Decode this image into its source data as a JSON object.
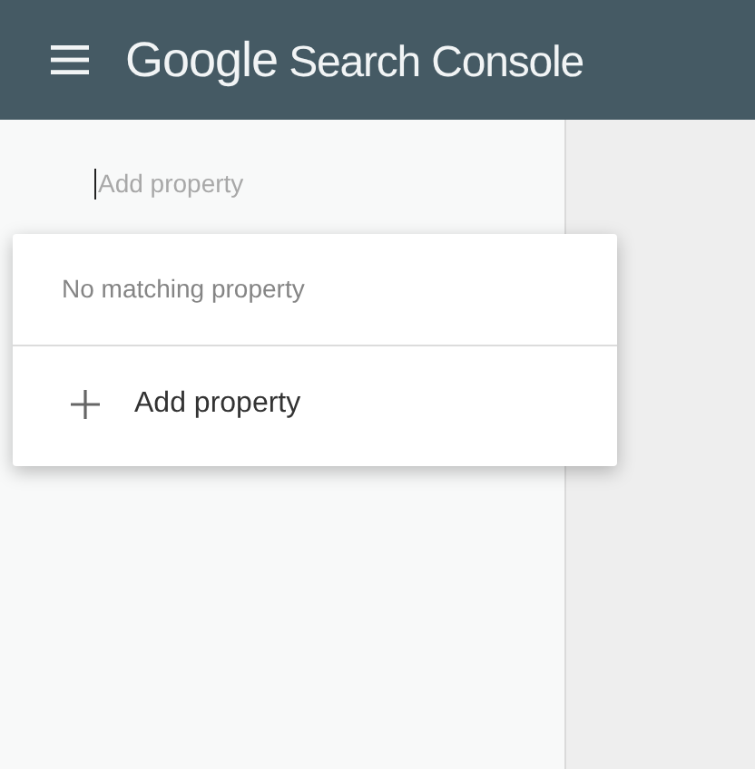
{
  "header": {
    "brand": "Google",
    "product": "Search Console"
  },
  "property_search": {
    "placeholder": "Add property"
  },
  "dropdown": {
    "message": "No matching property",
    "action": {
      "label": "Add property"
    }
  }
}
